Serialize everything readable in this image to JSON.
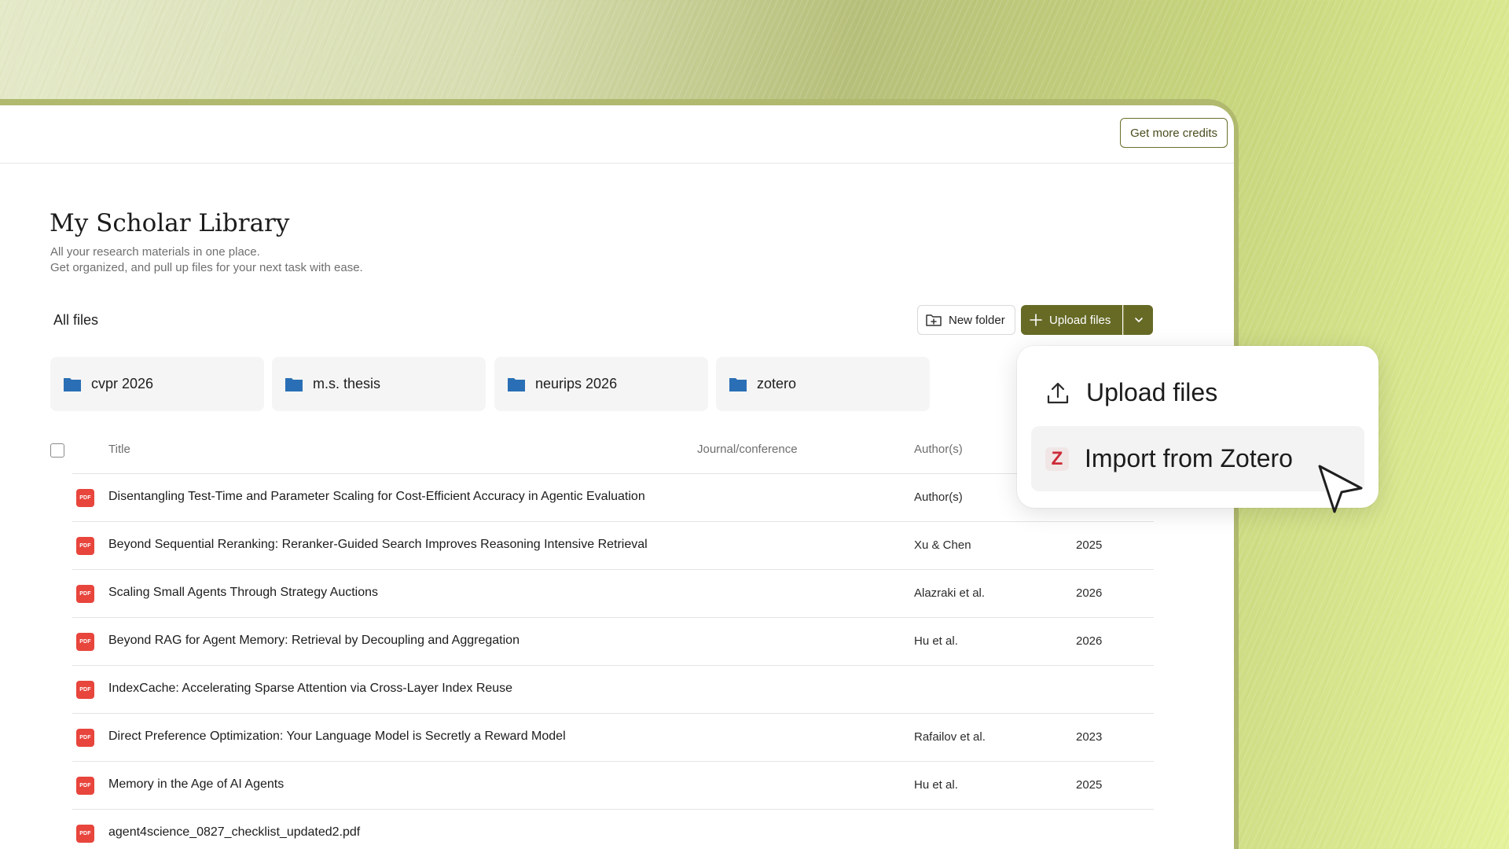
{
  "topbar": {
    "credits_label": "Get more credits"
  },
  "header": {
    "title": "My Scholar Library",
    "subtitle_line1": "All your research materials in one place.",
    "subtitle_line2": "Get organized, and pull up files for your next task with ease."
  },
  "toolbar": {
    "breadcrumb": "All files",
    "new_folder_label": "New folder",
    "upload_label": "Upload files"
  },
  "folders": [
    {
      "name": "cvpr 2026"
    },
    {
      "name": "m.s. thesis"
    },
    {
      "name": "neurips 2026"
    },
    {
      "name": "zotero"
    }
  ],
  "table": {
    "columns": {
      "title": "Title",
      "journal": "Journal/conference",
      "authors": "Author(s)"
    },
    "file_badge": "PDF",
    "rows": [
      {
        "title": "Disentangling Test-Time and Parameter Scaling for Cost-Efficient Accuracy in Agentic Evaluation",
        "authors": "Author(s)",
        "year": ""
      },
      {
        "title": "Beyond Sequential Reranking: Reranker-Guided Search Improves Reasoning Intensive Retrieval",
        "authors": "Xu & Chen",
        "year": "2025"
      },
      {
        "title": "Scaling Small Agents Through Strategy Auctions",
        "authors": "Alazraki et al.",
        "year": "2026"
      },
      {
        "title": "Beyond RAG for Agent Memory: Retrieval by Decoupling and Aggregation",
        "authors": "Hu et al.",
        "year": "2026"
      },
      {
        "title": "IndexCache: Accelerating Sparse Attention via Cross-Layer Index Reuse",
        "authors": "",
        "year": ""
      },
      {
        "title": "Direct Preference Optimization: Your Language Model is Secretly a Reward Model",
        "authors": "Rafailov et al.",
        "year": "2023"
      },
      {
        "title": "Memory in the Age of AI Agents",
        "authors": "Hu et al.",
        "year": "2025"
      },
      {
        "title": "agent4science_0827_checklist_updated2.pdf",
        "authors": "",
        "year": ""
      }
    ]
  },
  "popup": {
    "upload_label": "Upload files",
    "zotero_label": "Import from Zotero",
    "zotero_glyph": "Z"
  },
  "colors": {
    "accent": "#666a25",
    "folder": "#2a6fb5",
    "pdf_badge": "#e8453c",
    "zotero": "#cc2936"
  }
}
